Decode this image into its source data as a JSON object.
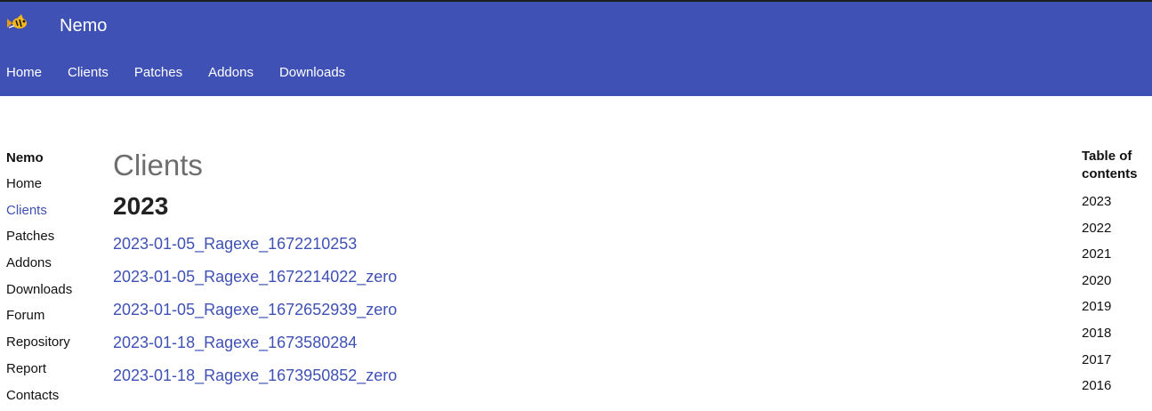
{
  "header": {
    "site_title": "Nemo",
    "logo_icon": "fish-logo-icon",
    "brand_color": "#3f51b5",
    "tabs": [
      {
        "label": "Home"
      },
      {
        "label": "Clients"
      },
      {
        "label": "Patches"
      },
      {
        "label": "Addons"
      },
      {
        "label": "Downloads"
      }
    ]
  },
  "sidebar": {
    "title": "Nemo",
    "active_item": "Clients",
    "items": [
      {
        "label": "Home"
      },
      {
        "label": "Clients"
      },
      {
        "label": "Patches"
      },
      {
        "label": "Addons"
      },
      {
        "label": "Downloads"
      },
      {
        "label": "Forum"
      },
      {
        "label": "Repository"
      },
      {
        "label": "Report"
      },
      {
        "label": "Contacts"
      }
    ]
  },
  "main": {
    "page_title": "Clients",
    "sections": [
      {
        "year": "2023",
        "clients": [
          "2023-01-05_Ragexe_1672210253",
          "2023-01-05_Ragexe_1672214022_zero",
          "2023-01-05_Ragexe_1672652939_zero",
          "2023-01-18_Ragexe_1673580284",
          "2023-01-18_Ragexe_1673950852_zero"
        ]
      }
    ]
  },
  "toc": {
    "title": "Table of contents",
    "items": [
      "2023",
      "2022",
      "2021",
      "2020",
      "2019",
      "2018",
      "2017",
      "2016"
    ]
  }
}
